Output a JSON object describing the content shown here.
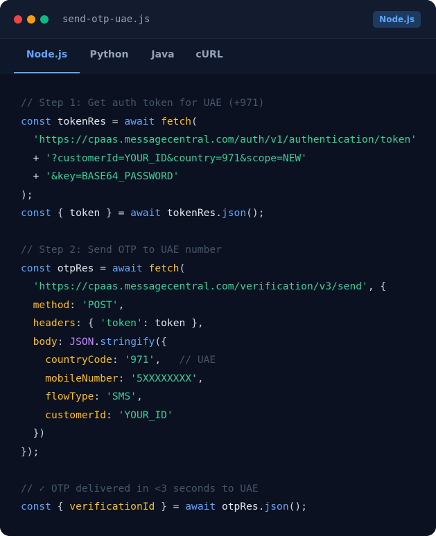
{
  "window": {
    "filename": "send-otp-uae.js",
    "language_badge": "Node.js"
  },
  "tabs": [
    {
      "label": "Node.js",
      "active": true
    },
    {
      "label": "Python",
      "active": false
    },
    {
      "label": "Java",
      "active": false
    },
    {
      "label": "cURL",
      "active": false
    }
  ],
  "code": {
    "lines": [
      [
        [
          "c",
          "// Step 1: Get auth token for UAE (+971)"
        ]
      ],
      [
        [
          "k",
          "const "
        ],
        [
          "v",
          "tokenRes "
        ],
        [
          "p",
          "= "
        ],
        [
          "k",
          "await "
        ],
        [
          "f",
          "fetch"
        ],
        [
          "p",
          "("
        ]
      ],
      [
        [
          "p",
          "  "
        ],
        [
          "s",
          "'https://cpaas.messagecentral.com/auth/v1/authentication/token'"
        ]
      ],
      [
        [
          "p",
          "  + "
        ],
        [
          "s",
          "'?customerId=YOUR_ID&country=971&scope=NEW'"
        ]
      ],
      [
        [
          "p",
          "  + "
        ],
        [
          "s",
          "'&key=BASE64_PASSWORD'"
        ]
      ],
      [
        [
          "p",
          ");"
        ]
      ],
      [
        [
          "k",
          "const "
        ],
        [
          "p",
          "{ "
        ],
        [
          "v",
          "token "
        ],
        [
          "p",
          "} = "
        ],
        [
          "k",
          "await "
        ],
        [
          "v",
          "tokenRes"
        ],
        [
          "p",
          "."
        ],
        [
          "k",
          "json"
        ],
        [
          "p",
          "();"
        ]
      ],
      [],
      [
        [
          "c",
          "// Step 2: Send OTP to UAE number"
        ]
      ],
      [
        [
          "k",
          "const "
        ],
        [
          "v",
          "otpRes "
        ],
        [
          "p",
          "= "
        ],
        [
          "k",
          "await "
        ],
        [
          "f",
          "fetch"
        ],
        [
          "p",
          "("
        ]
      ],
      [
        [
          "p",
          "  "
        ],
        [
          "s",
          "'https://cpaas.messagecentral.com/verification/v3/send'"
        ],
        [
          "p",
          ", {"
        ]
      ],
      [
        [
          "p",
          "  "
        ],
        [
          "pr",
          "method"
        ],
        [
          "p",
          ": "
        ],
        [
          "s",
          "'POST'"
        ],
        [
          "p",
          ","
        ]
      ],
      [
        [
          "p",
          "  "
        ],
        [
          "pr",
          "headers"
        ],
        [
          "p",
          ": { "
        ],
        [
          "s",
          "'token'"
        ],
        [
          "p",
          ": "
        ],
        [
          "v",
          "token "
        ],
        [
          "p",
          "},"
        ]
      ],
      [
        [
          "p",
          "  "
        ],
        [
          "pr",
          "body"
        ],
        [
          "p",
          ": "
        ],
        [
          "m",
          "JSON"
        ],
        [
          "p",
          "."
        ],
        [
          "k",
          "stringify"
        ],
        [
          "p",
          "({"
        ]
      ],
      [
        [
          "p",
          "    "
        ],
        [
          "pr",
          "countryCode"
        ],
        [
          "p",
          ": "
        ],
        [
          "s",
          "'971'"
        ],
        [
          "p",
          ",   "
        ],
        [
          "c",
          "// UAE"
        ]
      ],
      [
        [
          "p",
          "    "
        ],
        [
          "pr",
          "mobileNumber"
        ],
        [
          "p",
          ": "
        ],
        [
          "s",
          "'5XXXXXXXX'"
        ],
        [
          "p",
          ","
        ]
      ],
      [
        [
          "p",
          "    "
        ],
        [
          "pr",
          "flowType"
        ],
        [
          "p",
          ": "
        ],
        [
          "s",
          "'SMS'"
        ],
        [
          "p",
          ","
        ]
      ],
      [
        [
          "p",
          "    "
        ],
        [
          "pr",
          "customerId"
        ],
        [
          "p",
          ": "
        ],
        [
          "s",
          "'YOUR_ID'"
        ]
      ],
      [
        [
          "p",
          "  })"
        ]
      ],
      [
        [
          "p",
          "});"
        ]
      ],
      [],
      [
        [
          "c",
          "// ✓ OTP delivered in <3 seconds to UAE"
        ]
      ],
      [
        [
          "k",
          "const "
        ],
        [
          "p",
          "{ "
        ],
        [
          "pr",
          "verificationId "
        ],
        [
          "p",
          "} = "
        ],
        [
          "k",
          "await "
        ],
        [
          "v",
          "otpRes"
        ],
        [
          "p",
          "."
        ],
        [
          "k",
          "json"
        ],
        [
          "p",
          "();"
        ]
      ]
    ]
  }
}
